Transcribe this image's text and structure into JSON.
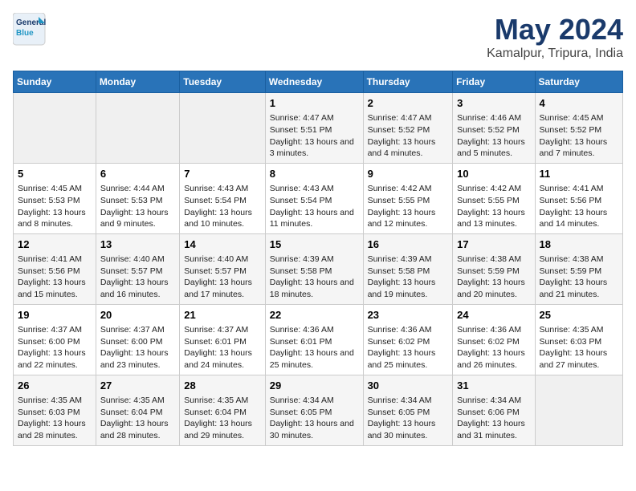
{
  "logo": {
    "line1": "General",
    "line2": "Blue"
  },
  "title": "May 2024",
  "subtitle": "Kamalpur, Tripura, India",
  "weekdays": [
    "Sunday",
    "Monday",
    "Tuesday",
    "Wednesday",
    "Thursday",
    "Friday",
    "Saturday"
  ],
  "weeks": [
    [
      {
        "day": "",
        "info": ""
      },
      {
        "day": "",
        "info": ""
      },
      {
        "day": "",
        "info": ""
      },
      {
        "day": "1",
        "info": "Sunrise: 4:47 AM\nSunset: 5:51 PM\nDaylight: 13 hours and 3 minutes."
      },
      {
        "day": "2",
        "info": "Sunrise: 4:47 AM\nSunset: 5:52 PM\nDaylight: 13 hours and 4 minutes."
      },
      {
        "day": "3",
        "info": "Sunrise: 4:46 AM\nSunset: 5:52 PM\nDaylight: 13 hours and 5 minutes."
      },
      {
        "day": "4",
        "info": "Sunrise: 4:45 AM\nSunset: 5:52 PM\nDaylight: 13 hours and 7 minutes."
      }
    ],
    [
      {
        "day": "5",
        "info": "Sunrise: 4:45 AM\nSunset: 5:53 PM\nDaylight: 13 hours and 8 minutes."
      },
      {
        "day": "6",
        "info": "Sunrise: 4:44 AM\nSunset: 5:53 PM\nDaylight: 13 hours and 9 minutes."
      },
      {
        "day": "7",
        "info": "Sunrise: 4:43 AM\nSunset: 5:54 PM\nDaylight: 13 hours and 10 minutes."
      },
      {
        "day": "8",
        "info": "Sunrise: 4:43 AM\nSunset: 5:54 PM\nDaylight: 13 hours and 11 minutes."
      },
      {
        "day": "9",
        "info": "Sunrise: 4:42 AM\nSunset: 5:55 PM\nDaylight: 13 hours and 12 minutes."
      },
      {
        "day": "10",
        "info": "Sunrise: 4:42 AM\nSunset: 5:55 PM\nDaylight: 13 hours and 13 minutes."
      },
      {
        "day": "11",
        "info": "Sunrise: 4:41 AM\nSunset: 5:56 PM\nDaylight: 13 hours and 14 minutes."
      }
    ],
    [
      {
        "day": "12",
        "info": "Sunrise: 4:41 AM\nSunset: 5:56 PM\nDaylight: 13 hours and 15 minutes."
      },
      {
        "day": "13",
        "info": "Sunrise: 4:40 AM\nSunset: 5:57 PM\nDaylight: 13 hours and 16 minutes."
      },
      {
        "day": "14",
        "info": "Sunrise: 4:40 AM\nSunset: 5:57 PM\nDaylight: 13 hours and 17 minutes."
      },
      {
        "day": "15",
        "info": "Sunrise: 4:39 AM\nSunset: 5:58 PM\nDaylight: 13 hours and 18 minutes."
      },
      {
        "day": "16",
        "info": "Sunrise: 4:39 AM\nSunset: 5:58 PM\nDaylight: 13 hours and 19 minutes."
      },
      {
        "day": "17",
        "info": "Sunrise: 4:38 AM\nSunset: 5:59 PM\nDaylight: 13 hours and 20 minutes."
      },
      {
        "day": "18",
        "info": "Sunrise: 4:38 AM\nSunset: 5:59 PM\nDaylight: 13 hours and 21 minutes."
      }
    ],
    [
      {
        "day": "19",
        "info": "Sunrise: 4:37 AM\nSunset: 6:00 PM\nDaylight: 13 hours and 22 minutes."
      },
      {
        "day": "20",
        "info": "Sunrise: 4:37 AM\nSunset: 6:00 PM\nDaylight: 13 hours and 23 minutes."
      },
      {
        "day": "21",
        "info": "Sunrise: 4:37 AM\nSunset: 6:01 PM\nDaylight: 13 hours and 24 minutes."
      },
      {
        "day": "22",
        "info": "Sunrise: 4:36 AM\nSunset: 6:01 PM\nDaylight: 13 hours and 25 minutes."
      },
      {
        "day": "23",
        "info": "Sunrise: 4:36 AM\nSunset: 6:02 PM\nDaylight: 13 hours and 25 minutes."
      },
      {
        "day": "24",
        "info": "Sunrise: 4:36 AM\nSunset: 6:02 PM\nDaylight: 13 hours and 26 minutes."
      },
      {
        "day": "25",
        "info": "Sunrise: 4:35 AM\nSunset: 6:03 PM\nDaylight: 13 hours and 27 minutes."
      }
    ],
    [
      {
        "day": "26",
        "info": "Sunrise: 4:35 AM\nSunset: 6:03 PM\nDaylight: 13 hours and 28 minutes."
      },
      {
        "day": "27",
        "info": "Sunrise: 4:35 AM\nSunset: 6:04 PM\nDaylight: 13 hours and 28 minutes."
      },
      {
        "day": "28",
        "info": "Sunrise: 4:35 AM\nSunset: 6:04 PM\nDaylight: 13 hours and 29 minutes."
      },
      {
        "day": "29",
        "info": "Sunrise: 4:34 AM\nSunset: 6:05 PM\nDaylight: 13 hours and 30 minutes."
      },
      {
        "day": "30",
        "info": "Sunrise: 4:34 AM\nSunset: 6:05 PM\nDaylight: 13 hours and 30 minutes."
      },
      {
        "day": "31",
        "info": "Sunrise: 4:34 AM\nSunset: 6:06 PM\nDaylight: 13 hours and 31 minutes."
      },
      {
        "day": "",
        "info": ""
      }
    ]
  ]
}
